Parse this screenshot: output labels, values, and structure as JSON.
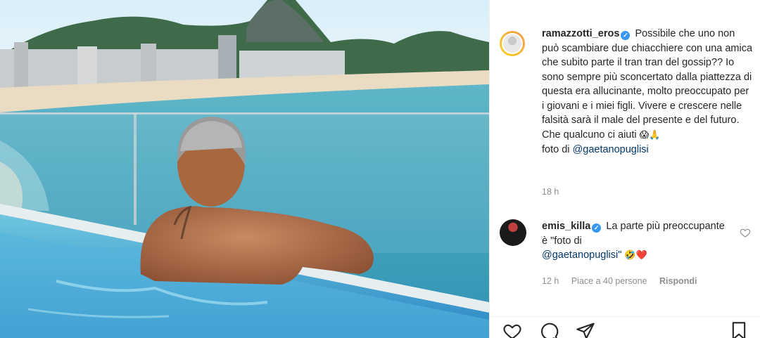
{
  "post": {
    "username": "ramazzotti_eros",
    "caption_text": "Possibile che uno non può scambiare due chiacchiere con una amica che subito parte il tran tran del gossip?? Io sono sempre più sconcertato dalla piattezza di questa era allucinante, molto preoccupato per i giovani e i miei figli. Vivere e crescere nelle falsità sarà il male del presente e del futuro. Che qualcuno ci aiuti",
    "caption_emojis": "😱🙏",
    "photo_credit_prefix": "foto di",
    "photo_credit_mention": "@gaetanopuglisi",
    "time": "18 h"
  },
  "comment": {
    "username": "emis_killa",
    "text": "La parte più preoccupante è \"foto di",
    "mention": "@gaetanopuglisi\"",
    "emojis": "🤣❤️",
    "time": "12 h",
    "likes": "Piace a 40 persone",
    "reply_label": "Rispondi"
  },
  "actions": {
    "icons": [
      "heart-icon",
      "comment-icon",
      "share-icon",
      "bookmark-icon"
    ]
  },
  "colors": {
    "verified": "#3897f0",
    "mention": "#00376b",
    "muted": "#8e8e8e"
  }
}
